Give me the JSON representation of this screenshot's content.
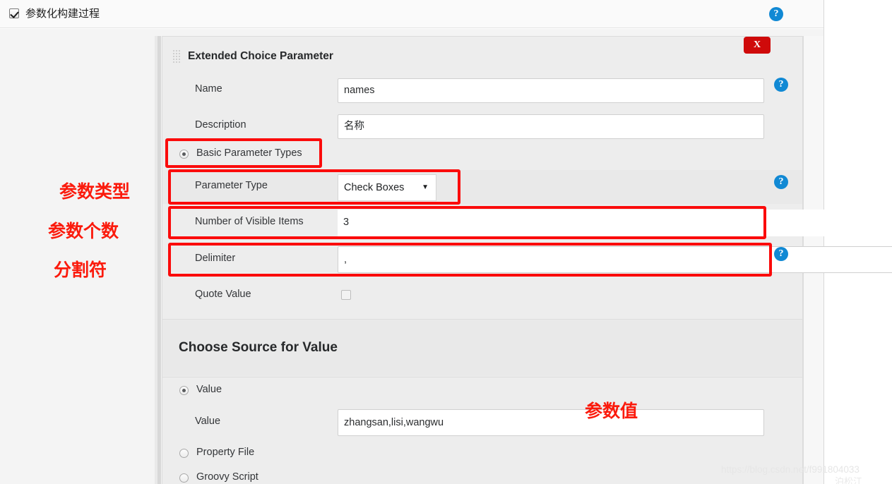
{
  "topbar": {
    "checkbox_label": "参数化构建过程",
    "checkbox_checked": true,
    "help_icon": "help-icon"
  },
  "panel": {
    "title": "Extended Choice Parameter",
    "close_label": "X",
    "grip_icon": "drag-grip-icon"
  },
  "fields": {
    "name_label": "Name",
    "name_value": "names",
    "description_label": "Description",
    "description_value": "名称",
    "basic_types_label": "Basic Parameter Types",
    "parameter_type_label": "Parameter Type",
    "parameter_type_value": "Check Boxes",
    "parameter_type_caret": "▼",
    "visible_items_label": "Number of Visible Items",
    "visible_items_value": "3",
    "delimiter_label": "Delimiter",
    "delimiter_value": ",",
    "quote_value_label": "Quote Value",
    "quote_value_checked": false
  },
  "source_section": {
    "heading": "Choose Source for Value",
    "value_radio_label": "Value",
    "value_field_label": "Value",
    "value_field_value": "zhangsan,lisi,wangwu",
    "property_file_label": "Property File",
    "groovy_script_label": "Groovy Script"
  },
  "annotations": {
    "note_type": "参数类型",
    "note_count": "参数个数",
    "note_delimiter": "分割符",
    "note_value": "参数值",
    "color": "#fb1a0c",
    "highlight_color": "#fb0b0b"
  },
  "watermark": {
    "url": "https://blog.csdn.net/f991804033",
    "secondary": "泊松江"
  },
  "colors": {
    "accent_help": "#1189d4",
    "close_red": "#cf0a0a",
    "panel_bg": "#ededed",
    "row_shade": "#e9e9e9",
    "page_bg": "#f4f4f4"
  }
}
